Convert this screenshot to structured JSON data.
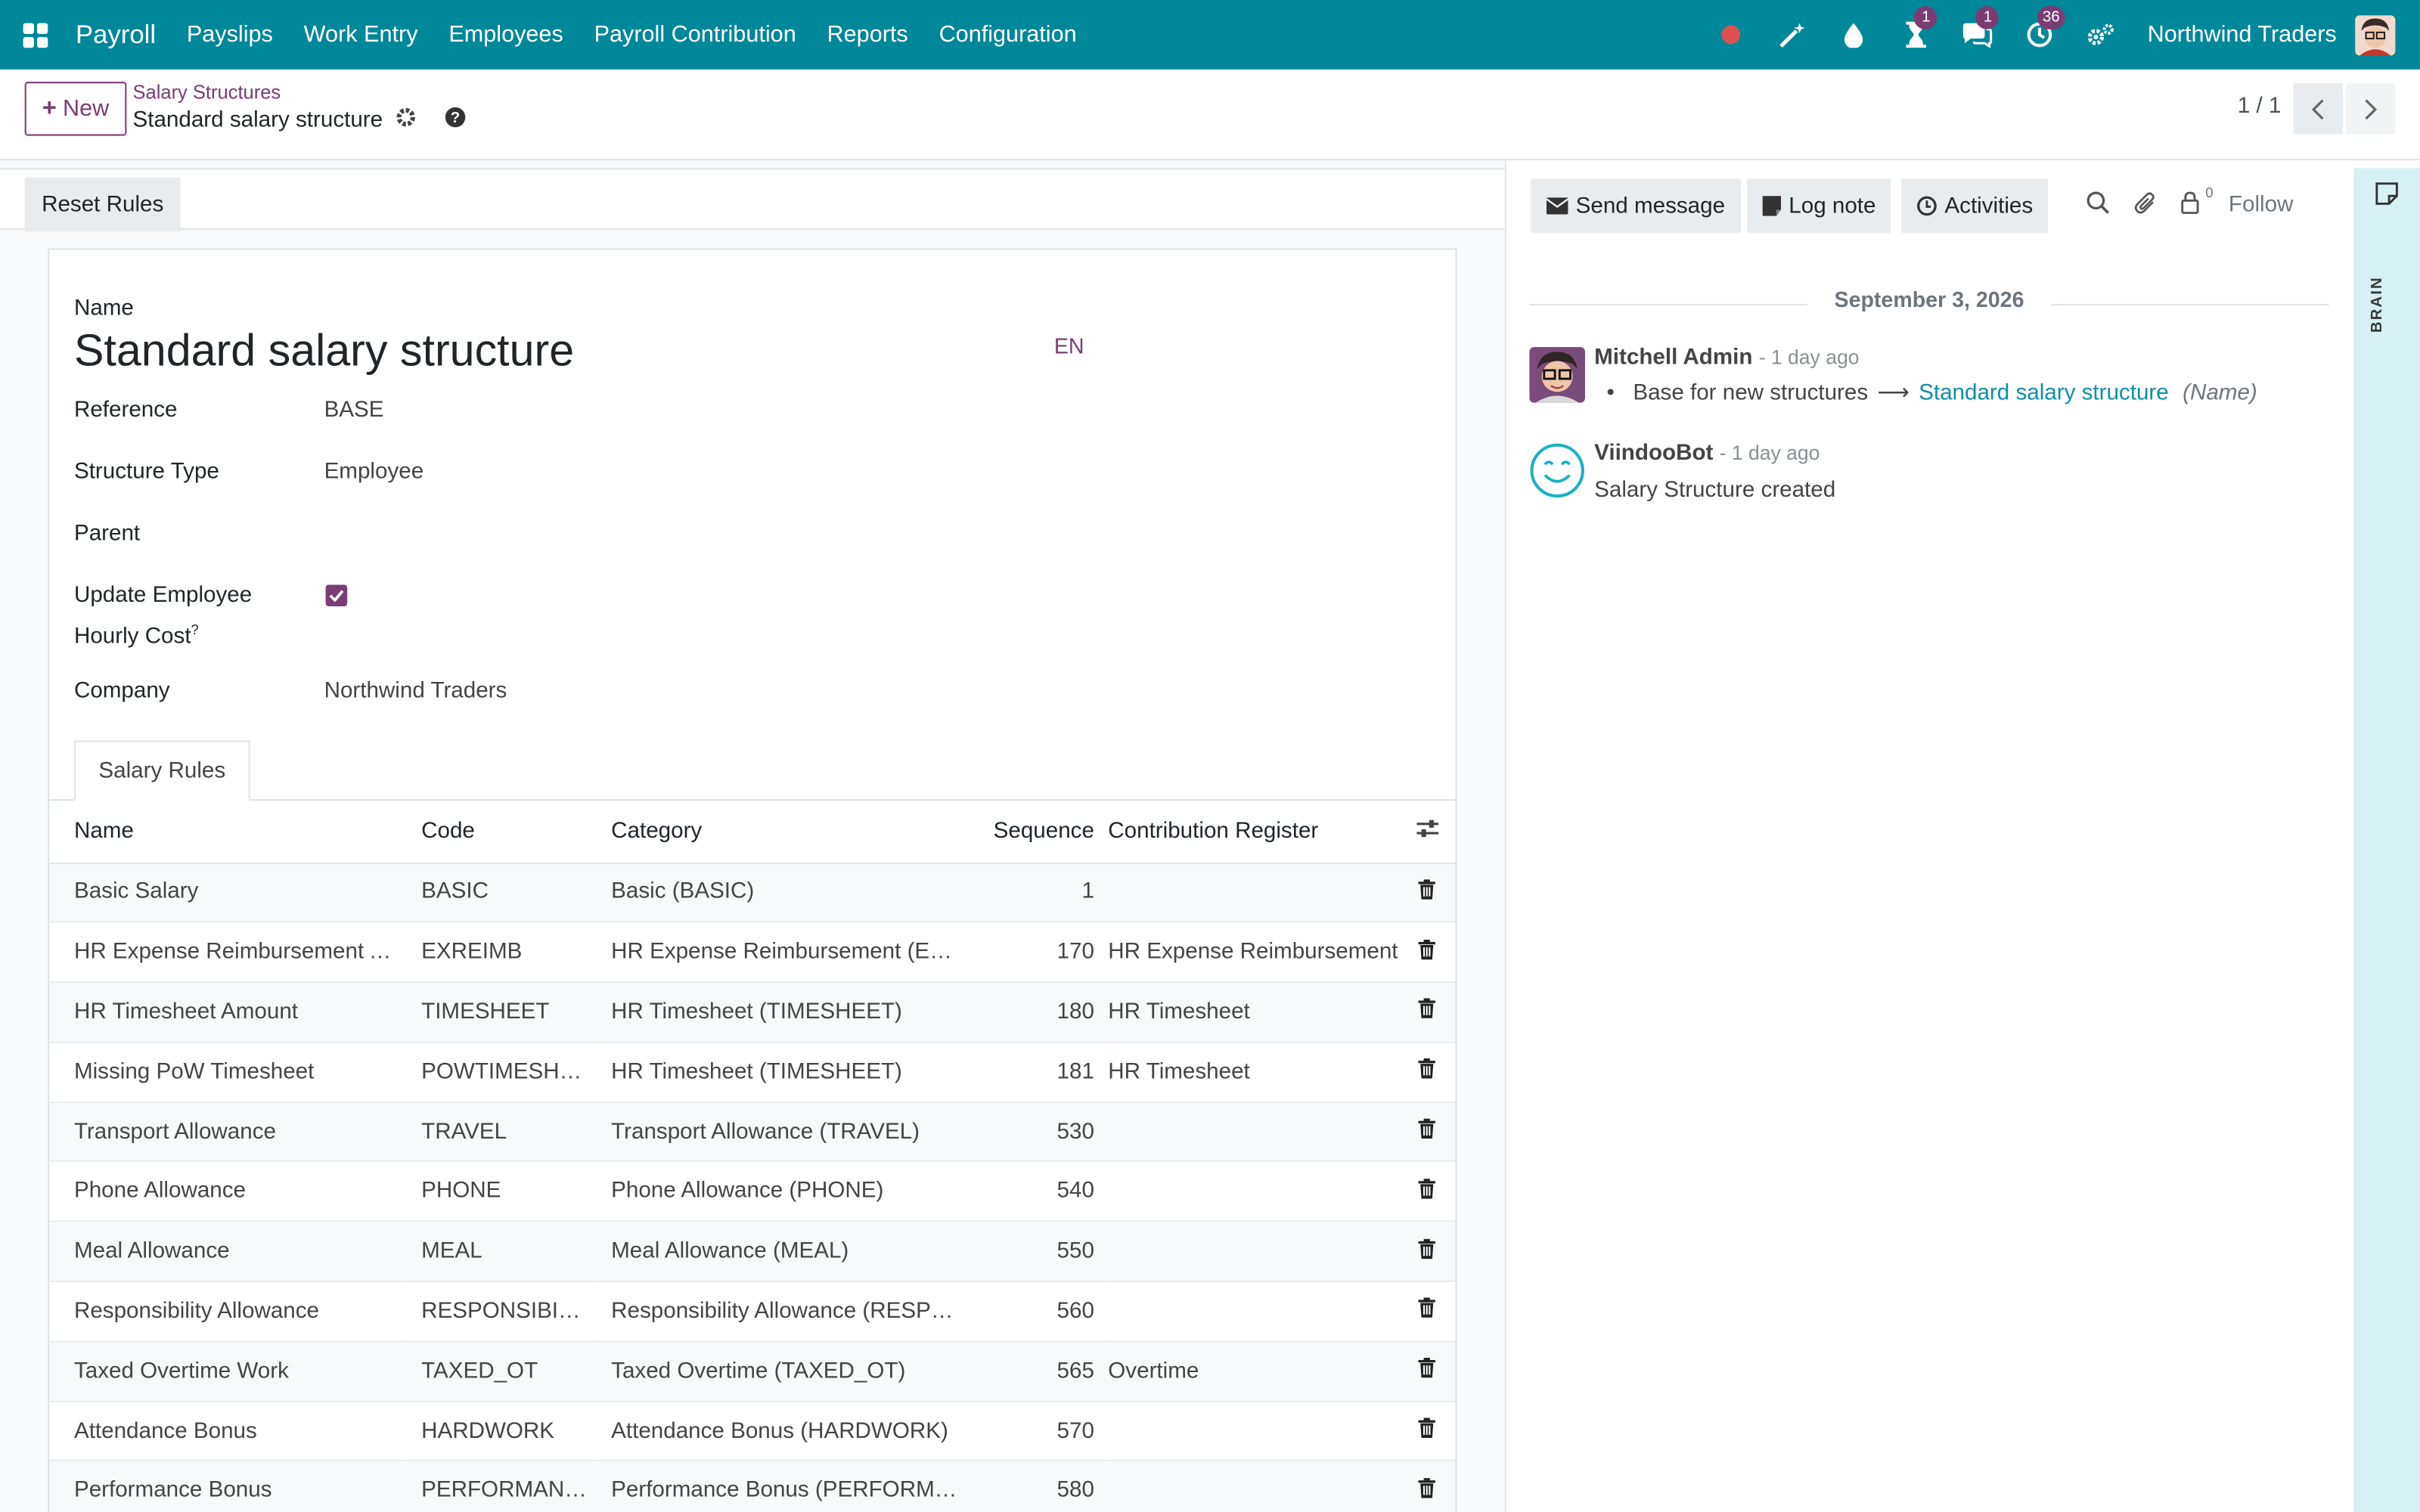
{
  "topbar": {
    "app_name": "Payroll",
    "menu": [
      "Payslips",
      "Work Entry",
      "Employees",
      "Payroll Contribution",
      "Reports",
      "Configuration"
    ],
    "badges": {
      "activity_timer": "1",
      "messages": "1",
      "clock": "36"
    },
    "company": "Northwind Traders"
  },
  "control_panel": {
    "new_label": "New",
    "breadcrumb_parent": "Salary Structures",
    "breadcrumb_current": "Standard salary structure",
    "pager": "1 / 1"
  },
  "form": {
    "reset_rules_label": "Reset Rules",
    "name_label": "Name",
    "name_value": "Standard salary structure",
    "lang": "EN",
    "reference_label": "Reference",
    "reference_value": "BASE",
    "structure_type_label": "Structure Type",
    "structure_type_value": "Employee",
    "parent_label": "Parent",
    "update_cost_label_1": "Update Employee",
    "update_cost_label_2": "Hourly Cost",
    "help_mark": "?",
    "update_cost_checked": true,
    "company_label": "Company",
    "company_value": "Northwind Traders",
    "tab_label": "Salary Rules"
  },
  "rules_table": {
    "columns": [
      "Name",
      "Code",
      "Category",
      "Sequence",
      "Contribution Register"
    ],
    "rows": [
      {
        "name": "Basic Salary",
        "code": "BASIC",
        "category": "Basic (BASIC)",
        "sequence": "1",
        "register": ""
      },
      {
        "name": "HR Expense Reimbursement Amount",
        "code": "EXREIMB",
        "category": "HR Expense Reimbursement (EXREIMB)",
        "sequence": "170",
        "register": "HR Expense Reimbursement"
      },
      {
        "name": "HR Timesheet Amount",
        "code": "TIMESHEET",
        "category": "HR Timesheet (TIMESHEET)",
        "sequence": "180",
        "register": "HR Timesheet"
      },
      {
        "name": "Missing PoW Timesheet",
        "code": "POWTIMESHEET",
        "category": "HR Timesheet (TIMESHEET)",
        "sequence": "181",
        "register": "HR Timesheet"
      },
      {
        "name": "Transport Allowance",
        "code": "TRAVEL",
        "category": "Transport Allowance (TRAVEL)",
        "sequence": "530",
        "register": ""
      },
      {
        "name": "Phone Allowance",
        "code": "PHONE",
        "category": "Phone Allowance (PHONE)",
        "sequence": "540",
        "register": ""
      },
      {
        "name": "Meal Allowance",
        "code": "MEAL",
        "category": "Meal Allowance (MEAL)",
        "sequence": "550",
        "register": ""
      },
      {
        "name": "Responsibility Allowance",
        "code": "RESPONSIBILITY",
        "category": "Responsibility Allowance (RESPONSIBILITY)",
        "sequence": "560",
        "register": ""
      },
      {
        "name": "Taxed Overtime Work",
        "code": "TAXED_OT",
        "category": "Taxed Overtime (TAXED_OT)",
        "sequence": "565",
        "register": "Overtime"
      },
      {
        "name": "Attendance Bonus",
        "code": "HARDWORK",
        "category": "Attendance Bonus (HARDWORK)",
        "sequence": "570",
        "register": ""
      },
      {
        "name": "Performance Bonus",
        "code": "PERFORMANCE",
        "category": "Performance Bonus (PERFORMANCE)",
        "sequence": "580",
        "register": ""
      }
    ]
  },
  "chatter": {
    "send_message": "Send message",
    "log_note": "Log note",
    "activities": "Activities",
    "follower_count": "0",
    "follow": "Follow",
    "date": "September 3, 2026",
    "messages": [
      {
        "author": "Mitchell Admin",
        "ago": "- 1 day ago",
        "old_value": "Base for new structures",
        "new_value": "Standard salary structure",
        "field": "(Name)"
      },
      {
        "author": "ViindooBot",
        "ago": "- 1 day ago",
        "body": "Salary Structure created"
      }
    ]
  },
  "side_panel": {
    "label": "BRAIN"
  },
  "colors": {
    "navbar": "#01879a",
    "primary": "#7b3c74",
    "link": "#0f8ea8"
  }
}
